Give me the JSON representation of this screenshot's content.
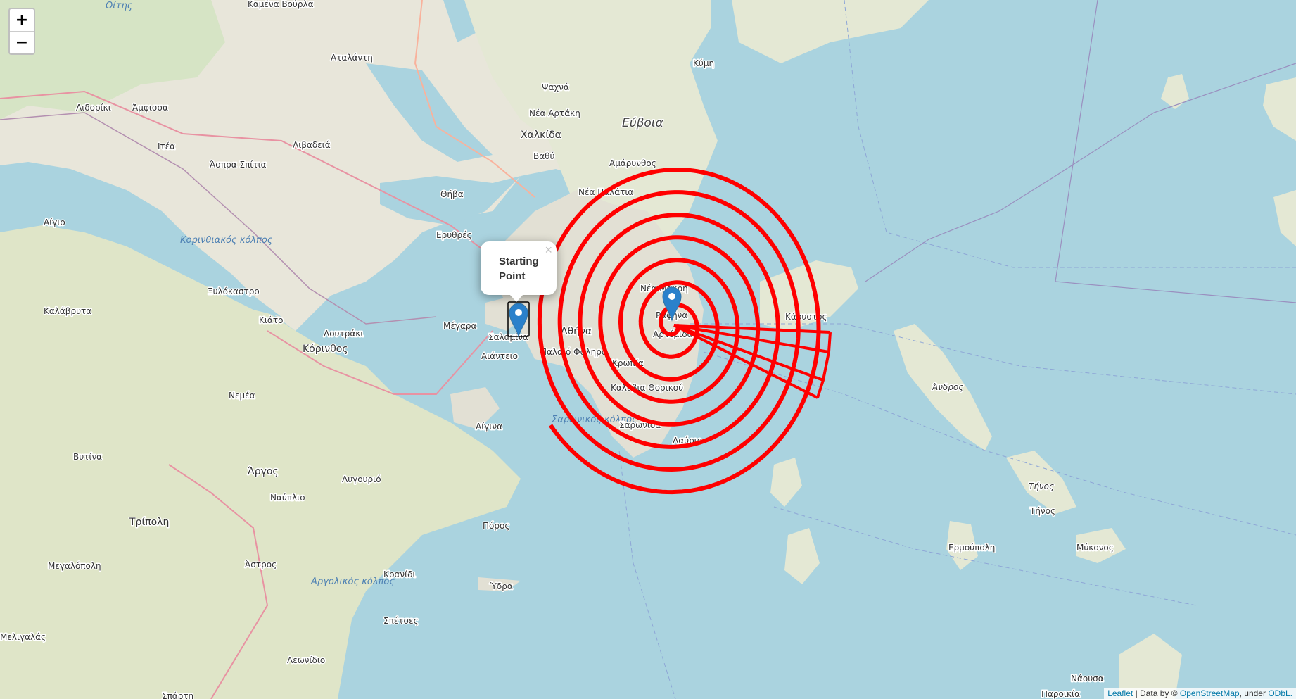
{
  "zoom": {
    "in_label": "+",
    "out_label": "−"
  },
  "popup": {
    "text": "Starting Point",
    "close_label": "×"
  },
  "attribution": {
    "leaflet": "Leaflet",
    "separator": " | Data by © ",
    "osm": "OpenStreetMap",
    "under": ", under ",
    "odbl": "ODbL."
  },
  "places": {
    "kamena_vourla": "Καμένα Βούρλα",
    "oitis": "Οίτης",
    "atalanti": "Αταλάντη",
    "lidoriki": "Λιδορίκι",
    "amfissa": "Άμφισσα",
    "psachna": "Ψαχνά",
    "nea_artaki": "Νέα Αρτάκη",
    "chalkida": "Χαλκίδα",
    "evia": "Εύβοια",
    "kymi": "Κύμη",
    "itea": "Ιτέα",
    "livadeia": "Λιβαδειά",
    "aspra_spitia": "Άσπρα Σπίτια",
    "vathy": "Βαθύ",
    "amarynthos": "Αμάρυνθος",
    "aigio": "Αίγιο",
    "thiva": "Θήβα",
    "nea_palatia": "Νέα Παλάτια",
    "korinthiakos": "Κορινθιακός κόλπος",
    "erythres": "Ερυθρές",
    "kalavryta": "Καλάβρυτα",
    "xylokastro": "Ξυλόκαστρο",
    "kiato": "Κιάτο",
    "megara": "Μέγαρα",
    "nea_makri": "Νέα Μάκρη",
    "rafina": "Ραφήνα",
    "artemida": "Αρτέμιδα",
    "athina": "Αθήνα",
    "loutraki": "Λουτράκι",
    "korinthos": "Κόρινθος",
    "salamina": "Σαλαμίνα",
    "aianteio": "Αιάντειο",
    "palaio_faliro": "Παλαιό Φάληρο",
    "kropia": "Κρωπία",
    "karystos": "Κάρυστος",
    "kalyvia": "Καλύβια Θορικού",
    "andros": "Άνδρος",
    "nemea": "Νεμέα",
    "aigina": "Αίγινα",
    "saronikos": "Σαρωνικός κόλπος",
    "saronida": "Σαρωνίδα",
    "lavrio": "Λαύριο",
    "vytina": "Βυτίνα",
    "argos": "Άργος",
    "lygourio": "Λυγουριό",
    "tinos_region": "Τήνος",
    "tinos": "Τήνος",
    "nafplio": "Ναύπλιο",
    "poros": "Πόρος",
    "tripoli": "Τρίπολη",
    "ermoupoli": "Ερμούπολη",
    "mykonos": "Μύκονος",
    "megalopoli": "Μεγαλόπολη",
    "astros": "Άστρος",
    "kranidi": "Κρανίδι",
    "ydra": "Ύδρα",
    "argolikos": "Αργολικός κόλπος",
    "spetses": "Σπέτσες",
    "meligalas": "Μελιγαλάς",
    "leonidio": "Λεωνίδιο",
    "sparti": "Σπάρτη",
    "naousa": "Νάουσα",
    "paroikia": "Παροικία"
  },
  "overlay": {
    "line_color": "#ff0000",
    "marker_color": "#2a81cb"
  }
}
